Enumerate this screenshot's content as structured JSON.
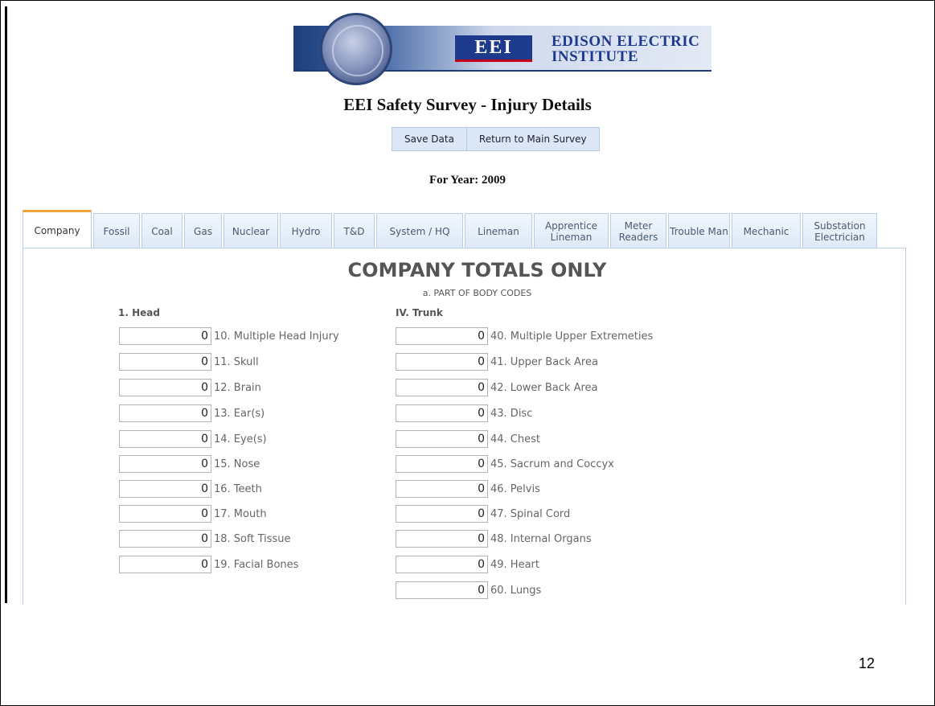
{
  "header": {
    "logo_letters": "EEI",
    "organization_line1": "EDISON ELECTRIC",
    "organization_line2": "INSTITUTE",
    "title": "EEI Safety Survey - Injury Details"
  },
  "actions": {
    "save_label": "Save Data",
    "return_label": "Return to Main Survey"
  },
  "year_label": "For Year: 2009",
  "tabs": [
    {
      "label": "Company",
      "active": true
    },
    {
      "label": "Fossil"
    },
    {
      "label": "Coal"
    },
    {
      "label": "Gas"
    },
    {
      "label": "Nuclear"
    },
    {
      "label": "Hydro"
    },
    {
      "label": "T&D"
    },
    {
      "label": "System / HQ"
    },
    {
      "label": "Lineman"
    },
    {
      "label": "Apprentice Lineman"
    },
    {
      "label": "Meter Readers"
    },
    {
      "label": "Trouble Man"
    },
    {
      "label": "Mechanic"
    },
    {
      "label": "Substation Electrician"
    }
  ],
  "panel": {
    "heading": "COMPANY TOTALS ONLY",
    "subheading": "a. PART OF BODY CODES",
    "head_group": {
      "label": "1. Head",
      "items": [
        {
          "value": "0",
          "label": "10. Multiple Head Injury"
        },
        {
          "value": "0",
          "label": "11. Skull"
        },
        {
          "value": "0",
          "label": "12. Brain"
        },
        {
          "value": "0",
          "label": "13. Ear(s)"
        },
        {
          "value": "0",
          "label": "14. Eye(s)"
        },
        {
          "value": "0",
          "label": "15. Nose"
        },
        {
          "value": "0",
          "label": "16. Teeth"
        },
        {
          "value": "0",
          "label": "17. Mouth"
        },
        {
          "value": "0",
          "label": "18. Soft Tissue"
        },
        {
          "value": "0",
          "label": "19. Facial Bones"
        }
      ]
    },
    "trunk_group": {
      "label": "IV. Trunk",
      "items": [
        {
          "value": "0",
          "label": "40. Multiple Upper Extremeties"
        },
        {
          "value": "0",
          "label": "41. Upper Back Area"
        },
        {
          "value": "0",
          "label": "42. Lower Back Area"
        },
        {
          "value": "0",
          "label": "43. Disc"
        },
        {
          "value": "0",
          "label": "44. Chest"
        },
        {
          "value": "0",
          "label": "45. Sacrum and Coccyx"
        },
        {
          "value": "0",
          "label": "46. Pelvis"
        },
        {
          "value": "0",
          "label": "47. Spinal Cord"
        },
        {
          "value": "0",
          "label": "48. Internal Organs"
        },
        {
          "value": "0",
          "label": "49. Heart"
        },
        {
          "value": "0",
          "label": "60. Lungs"
        }
      ]
    }
  },
  "page_number": "12"
}
